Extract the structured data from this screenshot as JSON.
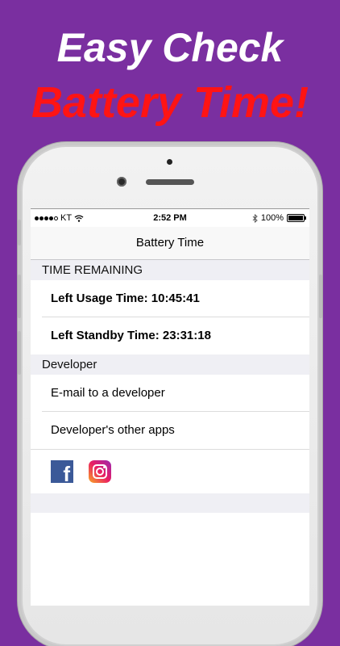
{
  "promo": {
    "line1": "Easy Check",
    "line2": "Battery Time!",
    "line1_color": "#ffffff",
    "line2_color": "#ff1414",
    "background_color": "#7a2fa0"
  },
  "statusbar": {
    "carrier": "KT",
    "time": "2:52 PM",
    "battery_percent": "100%",
    "battery_level": 1.0,
    "signal_bars": 4,
    "icons": [
      "signal-dots-icon",
      "wifi-icon",
      "bluetooth-icon",
      "battery-icon"
    ]
  },
  "navbar": {
    "title": "Battery Time"
  },
  "sections": {
    "time_remaining": {
      "header": "TIME REMAINING",
      "usage": "Left Usage Time: 10:45:41",
      "standby": "Left Standby Time: 23:31:18"
    },
    "developer": {
      "header": "Developer",
      "email": "E-mail to a developer",
      "other_apps": "Developer's other apps",
      "social_icons": [
        "facebook-icon",
        "instagram-icon"
      ]
    }
  },
  "icon_glyphs": {
    "facebook": "f"
  }
}
